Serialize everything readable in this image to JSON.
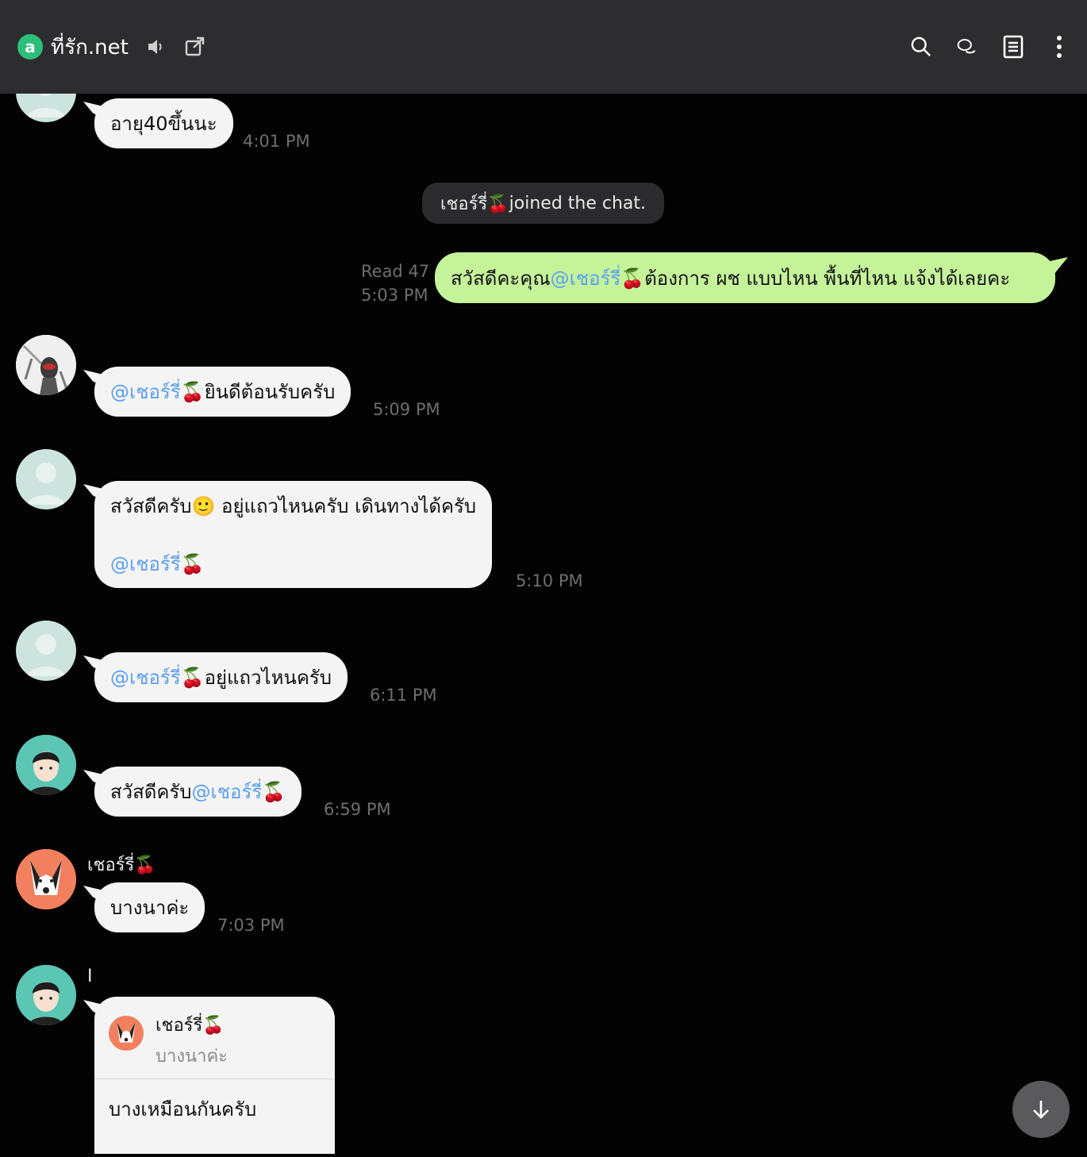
{
  "header": {
    "title": "ที่รัก.net",
    "logo_letter": "a",
    "icons": [
      "speaker-icon",
      "external-link-icon",
      "search-icon",
      "chat-bubbles-icon",
      "notes-icon",
      "more-icon"
    ]
  },
  "messages": [
    {
      "text": "อายุ40ขึ้นนะ",
      "time": "4:01 PM"
    },
    {
      "system_name": "เชอร์รี่🍒",
      "system_suffix": " joined the chat."
    },
    {
      "read": "Read 47",
      "time": "5:03 PM",
      "pre": "สวัสดีคะคุณ ",
      "mention": "@เชอร์รี่🍒",
      "post": " ต้องการ ผช แบบไหน พื้นที่ไหน แจ้งได้เลยคะ"
    },
    {
      "mention": "@เชอร์รี่🍒",
      "post": " ยินดีต้อนรับครับ",
      "time": "5:09 PM"
    },
    {
      "pre": "สวัสดีครับ🙂 อยู่แถวไหนครับ เดินทางได้ครับ",
      "mention": "@เชอร์รี่🍒",
      "time": "5:10 PM"
    },
    {
      "mention": "@เชอร์รี่🍒",
      "post": " อยู่แถวไหนครับ",
      "time": "6:11 PM"
    },
    {
      "pre": "สวัสดีครับ ",
      "mention": "@เชอร์รี่🍒",
      "time": "6:59 PM"
    },
    {
      "name": "เชอร์รี่🍒",
      "text": "บางนาค่ะ",
      "time": "7:03 PM"
    },
    {
      "name": "I",
      "quote_name": "เชอร์รี่🍒",
      "quote_text": "บางนาค่ะ",
      "text": "บางเหมือนกันครับ"
    }
  ],
  "colors": {
    "header_bg": "#2d2d2f",
    "chat_bg": "#030303",
    "bubble": "#f4f4f4",
    "mine_bubble": "#c5f39a",
    "mention": "#5b9ff0",
    "brand": "#2dbf7a"
  }
}
